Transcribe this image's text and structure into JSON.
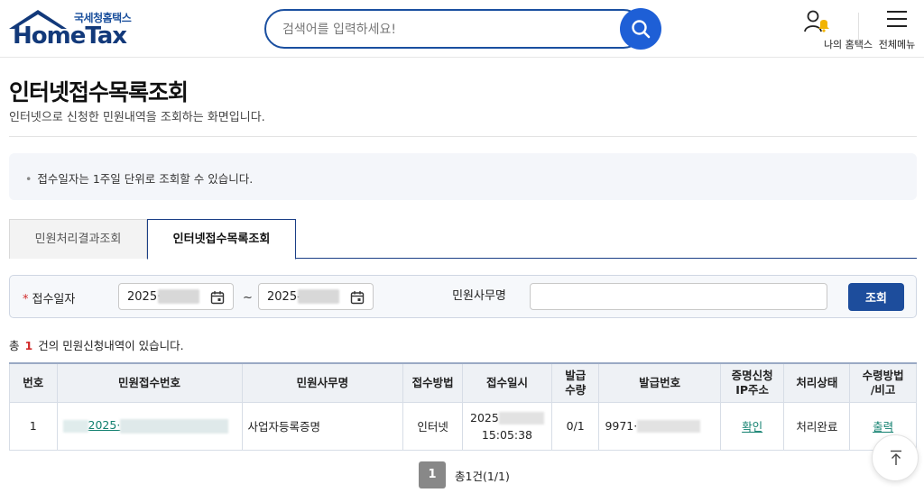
{
  "header": {
    "logo_sub": "국세청홈택스",
    "logo_main": "HomeTax",
    "search_placeholder": "검색어를 입력하세요!",
    "my_hometax": "나의 홈택스",
    "all_menu": "전체메뉴"
  },
  "page": {
    "title": "인터넷접수목록조회",
    "description": "인터넷으로 신청한 민원내역을 조회하는 화면입니다.",
    "notice": "접수일자는 1주일 단위로 조회할 수 있습니다."
  },
  "tabs": [
    {
      "label": "민원처리결과조회",
      "active": false
    },
    {
      "label": "인터넷접수목록조회",
      "active": true
    }
  ],
  "form": {
    "date_label": "접수일자",
    "date_from": "2025·",
    "tilde": "~",
    "date_to": "2025-",
    "task_label": "민원사무명",
    "task_value": "",
    "search_button": "조회"
  },
  "count": {
    "prefix": "총",
    "number": "1",
    "suffix": "건의 민원신청내역이 있습니다."
  },
  "table": {
    "headers": [
      "번호",
      "민원접수번호",
      "민원사무명",
      "접수방법",
      "접수일시",
      "발급\n수량",
      "발급번호",
      "증명신청\nIP주소",
      "처리상태",
      "수령방법\n/비고"
    ],
    "rows": [
      {
        "no": "1",
        "receipt_no": "2025·",
        "task": "사업자등록증명",
        "method": "인터넷",
        "date_line1": "2025",
        "date_line2": "15:05:38",
        "qty": "0/1",
        "issue_no": "9971·",
        "ip": "확인",
        "status": "처리완료",
        "receive": "출력"
      }
    ]
  },
  "pager": {
    "current": "1",
    "total": "총1건(1/1)"
  }
}
